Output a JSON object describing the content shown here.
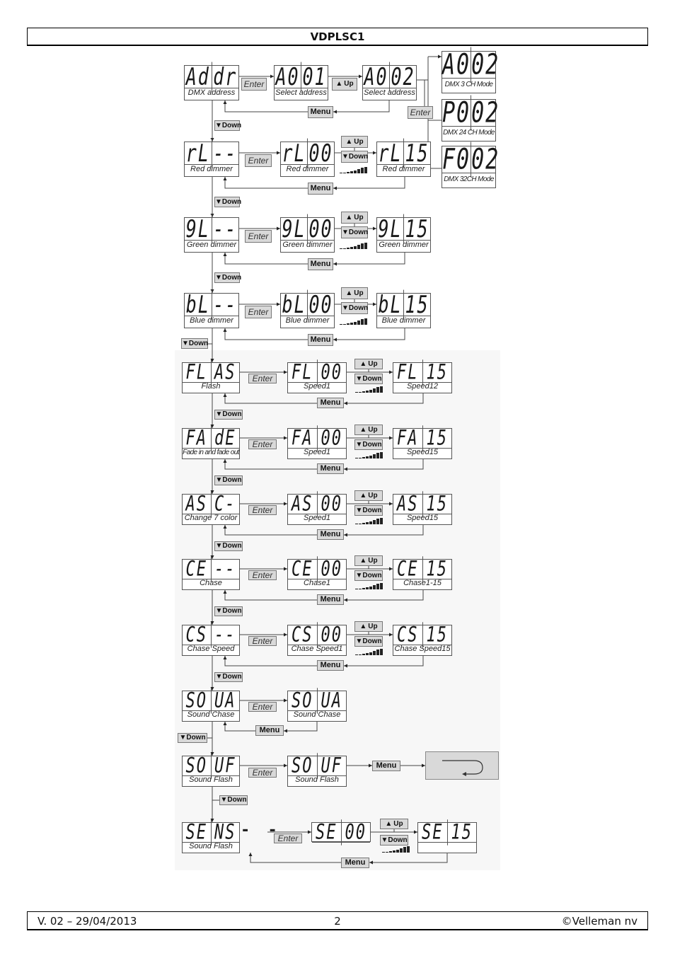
{
  "header": {
    "title": "VDPLSC1"
  },
  "footer": {
    "version": "V. 02 – 29/04/2013",
    "page": "2",
    "copyright": "©Velleman nv"
  },
  "buttons": {
    "enter": "Enter",
    "menu": "Menu",
    "up": "Up",
    "down": "Down",
    "up_glyph": "▲",
    "down_glyph": "▼"
  },
  "icons": {
    "return": "return-arrow-icon",
    "ramp": "increasing-bars-icon"
  },
  "rows": [
    {
      "id": "addr",
      "main": {
        "left": "Addr",
        "right": "dr",
        "left_a": "Ad",
        "caption": "DMX address"
      },
      "step1": {
        "left": "A0",
        "right": "01",
        "caption": "Select address"
      },
      "step2": {
        "left": "A0",
        "right": "02",
        "caption": "Select address"
      },
      "modes": [
        {
          "left": "A0",
          "right": "02",
          "caption": "DMX 3 CH Mode"
        },
        {
          "left": "P0",
          "right": "02",
          "caption": "DMX 24 CH Mode"
        },
        {
          "left": "F0",
          "right": "02",
          "caption": "DMX 32CH Mode"
        }
      ]
    },
    {
      "id": "red",
      "main": {
        "left": "rL",
        "right": "--",
        "caption": "Red dimmer"
      },
      "step1": {
        "left": "rL",
        "right": "00",
        "caption": "Red dimmer"
      },
      "step2": {
        "left": "rL",
        "right": "15",
        "caption": "Red dimmer"
      }
    },
    {
      "id": "green",
      "main": {
        "left": "9L",
        "right": "--",
        "caption": "Green dimmer"
      },
      "step1": {
        "left": "9L",
        "right": "00",
        "caption": "Green dimmer"
      },
      "step2": {
        "left": "9L",
        "right": "15",
        "caption": "Green dimmer"
      }
    },
    {
      "id": "blue",
      "main": {
        "left": "bL",
        "right": "--",
        "caption": "Blue dimmer"
      },
      "step1": {
        "left": "bL",
        "right": "00",
        "caption": "Blue dimmer"
      },
      "step2": {
        "left": "bL",
        "right": "15",
        "caption": "Blue dimmer"
      }
    },
    {
      "id": "flash",
      "main": {
        "left": "FL",
        "right": "AS",
        "caption": "Flash"
      },
      "step1": {
        "left": "FL",
        "right": "00",
        "caption": "Speed1"
      },
      "step2": {
        "left": "FL",
        "right": "15",
        "caption": "Speed12"
      }
    },
    {
      "id": "fade",
      "main": {
        "left": "FA",
        "right": "dE",
        "caption": "Fade in and fade out"
      },
      "step1": {
        "left": "FA",
        "right": "00",
        "caption": "Speed1"
      },
      "step2": {
        "left": "FA",
        "right": "15",
        "caption": "Speed15"
      }
    },
    {
      "id": "change7",
      "main": {
        "left": "AS",
        "right": "C-",
        "caption": "Change 7 color"
      },
      "step1": {
        "left": "AS",
        "right": "00",
        "caption": "Speed1"
      },
      "step2": {
        "left": "AS",
        "right": "15",
        "caption": "Speed15"
      }
    },
    {
      "id": "chase",
      "main": {
        "left": "CE",
        "right": "--",
        "caption": "Chase"
      },
      "step1": {
        "left": "CE",
        "right": "00",
        "caption": "Chase1"
      },
      "step2": {
        "left": "CE",
        "right": "15",
        "caption": "Chase1-15"
      }
    },
    {
      "id": "chasespeed",
      "main": {
        "left": "CS",
        "right": "--",
        "caption": "Chase Speed"
      },
      "step1": {
        "left": "CS",
        "right": "00",
        "caption": "Chase Speed1"
      },
      "step2": {
        "left": "CS",
        "right": "15",
        "caption": "Chase Speed15"
      }
    },
    {
      "id": "soundchase",
      "main": {
        "left": "SO",
        "right": "UA",
        "caption": "Sound Chase"
      },
      "step1": {
        "left": "SO",
        "right": "UA",
        "caption": "Sound Chase"
      }
    },
    {
      "id": "soundflash",
      "main": {
        "left": "SO",
        "right": "UF",
        "caption": "Sound Flash"
      },
      "step1": {
        "left": "SO",
        "right": "UF",
        "caption": "Sound Flash"
      }
    },
    {
      "id": "sens",
      "main": {
        "left": "SE",
        "right": "NS",
        "caption": "Sound Flash",
        "suffix": "- -"
      },
      "step1": {
        "left": "SE",
        "right": "00",
        "caption": ""
      },
      "step2": {
        "left": "SE",
        "right": "15",
        "caption": ""
      }
    }
  ]
}
